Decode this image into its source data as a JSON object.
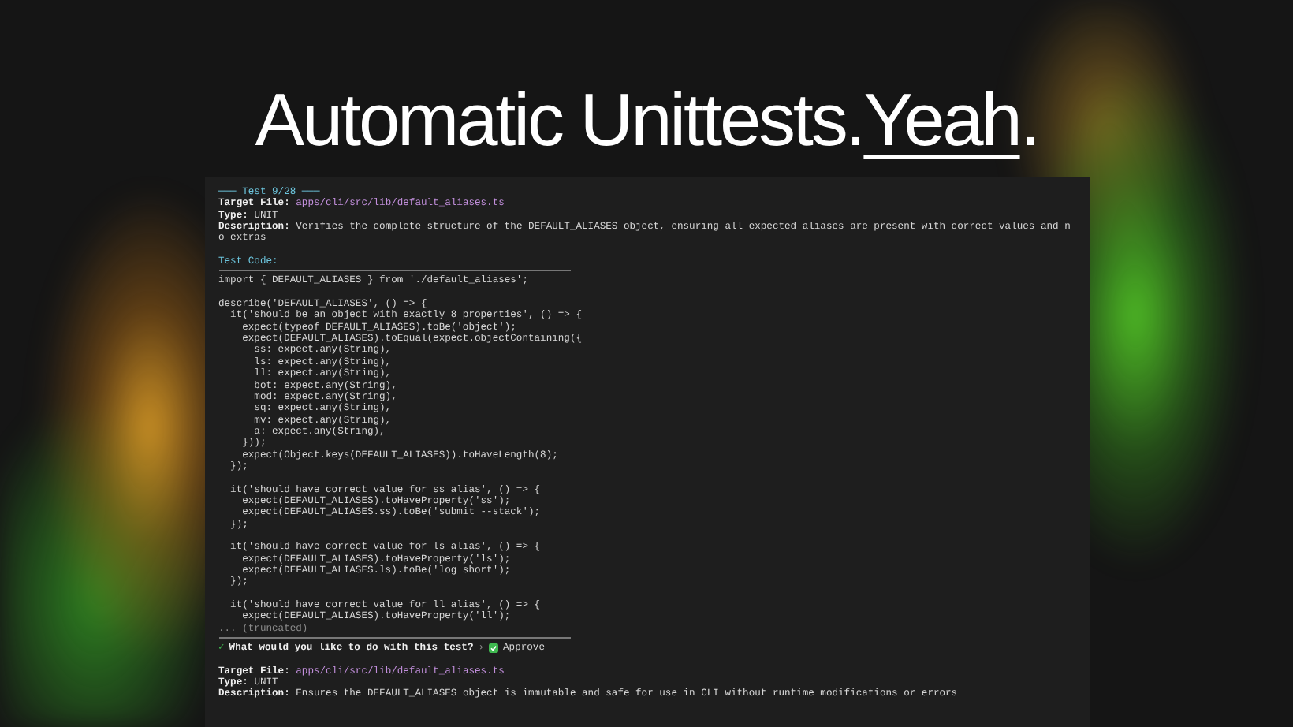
{
  "title": {
    "text": "Automatic Unittests.",
    "emphasis": "Yeah",
    "end": "."
  },
  "tests": [
    {
      "header": "─── Test 9/28 ───",
      "fields": [
        {
          "label": "Target File:",
          "value": "apps/cli/src/lib/default_aliases.ts",
          "kind": "path"
        },
        {
          "label": "Type:",
          "value": "UNIT",
          "kind": "plain"
        },
        {
          "label": "Description:",
          "value": "Verifies the complete structure of the DEFAULT_ALIASES object, ensuring all expected aliases are present with correct values and no extras",
          "kind": "plain"
        }
      ],
      "code_label": "Test Code:",
      "code": "import { DEFAULT_ALIASES } from './default_aliases';\n\ndescribe('DEFAULT_ALIASES', () => {\n  it('should be an object with exactly 8 properties', () => {\n    expect(typeof DEFAULT_ALIASES).toBe('object');\n    expect(DEFAULT_ALIASES).toEqual(expect.objectContaining({\n      ss: expect.any(String),\n      ls: expect.any(String),\n      ll: expect.any(String),\n      bot: expect.any(String),\n      mod: expect.any(String),\n      sq: expect.any(String),\n      mv: expect.any(String),\n      a: expect.any(String),\n    }));\n    expect(Object.keys(DEFAULT_ALIASES)).toHaveLength(8);\n  });\n\n  it('should have correct value for ss alias', () => {\n    expect(DEFAULT_ALIASES).toHaveProperty('ss');\n    expect(DEFAULT_ALIASES.ss).toBe('submit --stack');\n  });\n\n  it('should have correct value for ls alias', () => {\n    expect(DEFAULT_ALIASES).toHaveProperty('ls');\n    expect(DEFAULT_ALIASES.ls).toBe('log short');\n  });\n\n  it('should have correct value for ll alias', () => {\n    expect(DEFAULT_ALIASES).toHaveProperty('ll');",
      "truncated": "... (truncated)",
      "prompt": {
        "mark": "✓",
        "question": "What would you like to do with this test?",
        "separator": "›",
        "answer": "Approve"
      }
    },
    {
      "fields": [
        {
          "label": "Target File:",
          "value": "apps/cli/src/lib/default_aliases.ts",
          "kind": "path"
        },
        {
          "label": "Type:",
          "value": "UNIT",
          "kind": "plain"
        },
        {
          "label": "Description:",
          "value": "Ensures the DEFAULT_ALIASES object is immutable and safe for use in CLI without runtime modifications or errors",
          "kind": "plain"
        }
      ]
    }
  ]
}
